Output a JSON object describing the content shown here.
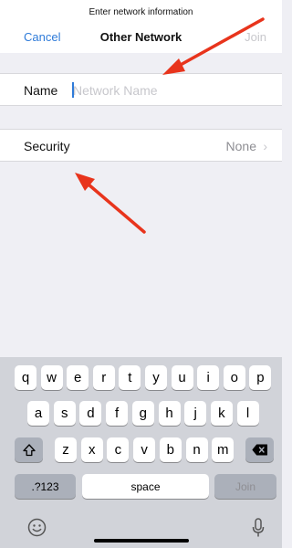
{
  "header": {
    "prompt": "Enter network information",
    "cancel_label": "Cancel",
    "title": "Other Network",
    "join_label": "Join"
  },
  "form": {
    "name_label": "Name",
    "name_placeholder": "Network Name",
    "name_value": "",
    "security_label": "Security",
    "security_value": "None",
    "chevron": "›"
  },
  "keyboard": {
    "row1": [
      "q",
      "w",
      "e",
      "r",
      "t",
      "y",
      "u",
      "i",
      "o",
      "p"
    ],
    "row2": [
      "a",
      "s",
      "d",
      "f",
      "g",
      "h",
      "j",
      "k",
      "l"
    ],
    "row3": [
      "z",
      "x",
      "c",
      "v",
      "b",
      "n",
      "m"
    ],
    "numbers_label": ".?123",
    "space_label": "space",
    "join_label": "Join",
    "shift_icon": "shift-icon",
    "delete_icon": "delete-icon",
    "emoji_icon": "emoji-icon",
    "mic_icon": "microphone-icon"
  },
  "colors": {
    "accent": "#2f7bd9",
    "background": "#efeff4",
    "keyboard": "#d1d3d9",
    "annotation_arrow": "#e8341c"
  }
}
